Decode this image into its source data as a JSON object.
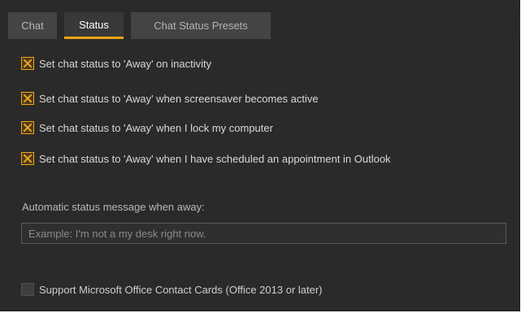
{
  "tabs": [
    {
      "label": "Chat",
      "active": false
    },
    {
      "label": "Status",
      "active": true
    },
    {
      "label": "Chat Status Presets",
      "active": false
    }
  ],
  "options": [
    {
      "label": "Set chat status to 'Away' on inactivity",
      "checked": true
    },
    {
      "label": "Set chat status to 'Away' when screensaver becomes active",
      "checked": true
    },
    {
      "label": "Set chat status to 'Away' when I lock my computer",
      "checked": true
    },
    {
      "label": "Set chat status to 'Away' when I have scheduled an appointment in Outlook",
      "checked": true
    }
  ],
  "away_message": {
    "label": "Automatic status message when away:",
    "value": "",
    "placeholder": "Example: I'm not a my desk right now."
  },
  "office_cards": {
    "label": "Support Microsoft Office Contact Cards (Office 2013 or later)",
    "checked": false
  },
  "colors": {
    "accent": "#f0a418",
    "background": "#2a2a2a",
    "tab_inactive": "#444444",
    "tab_active": "#383838"
  }
}
